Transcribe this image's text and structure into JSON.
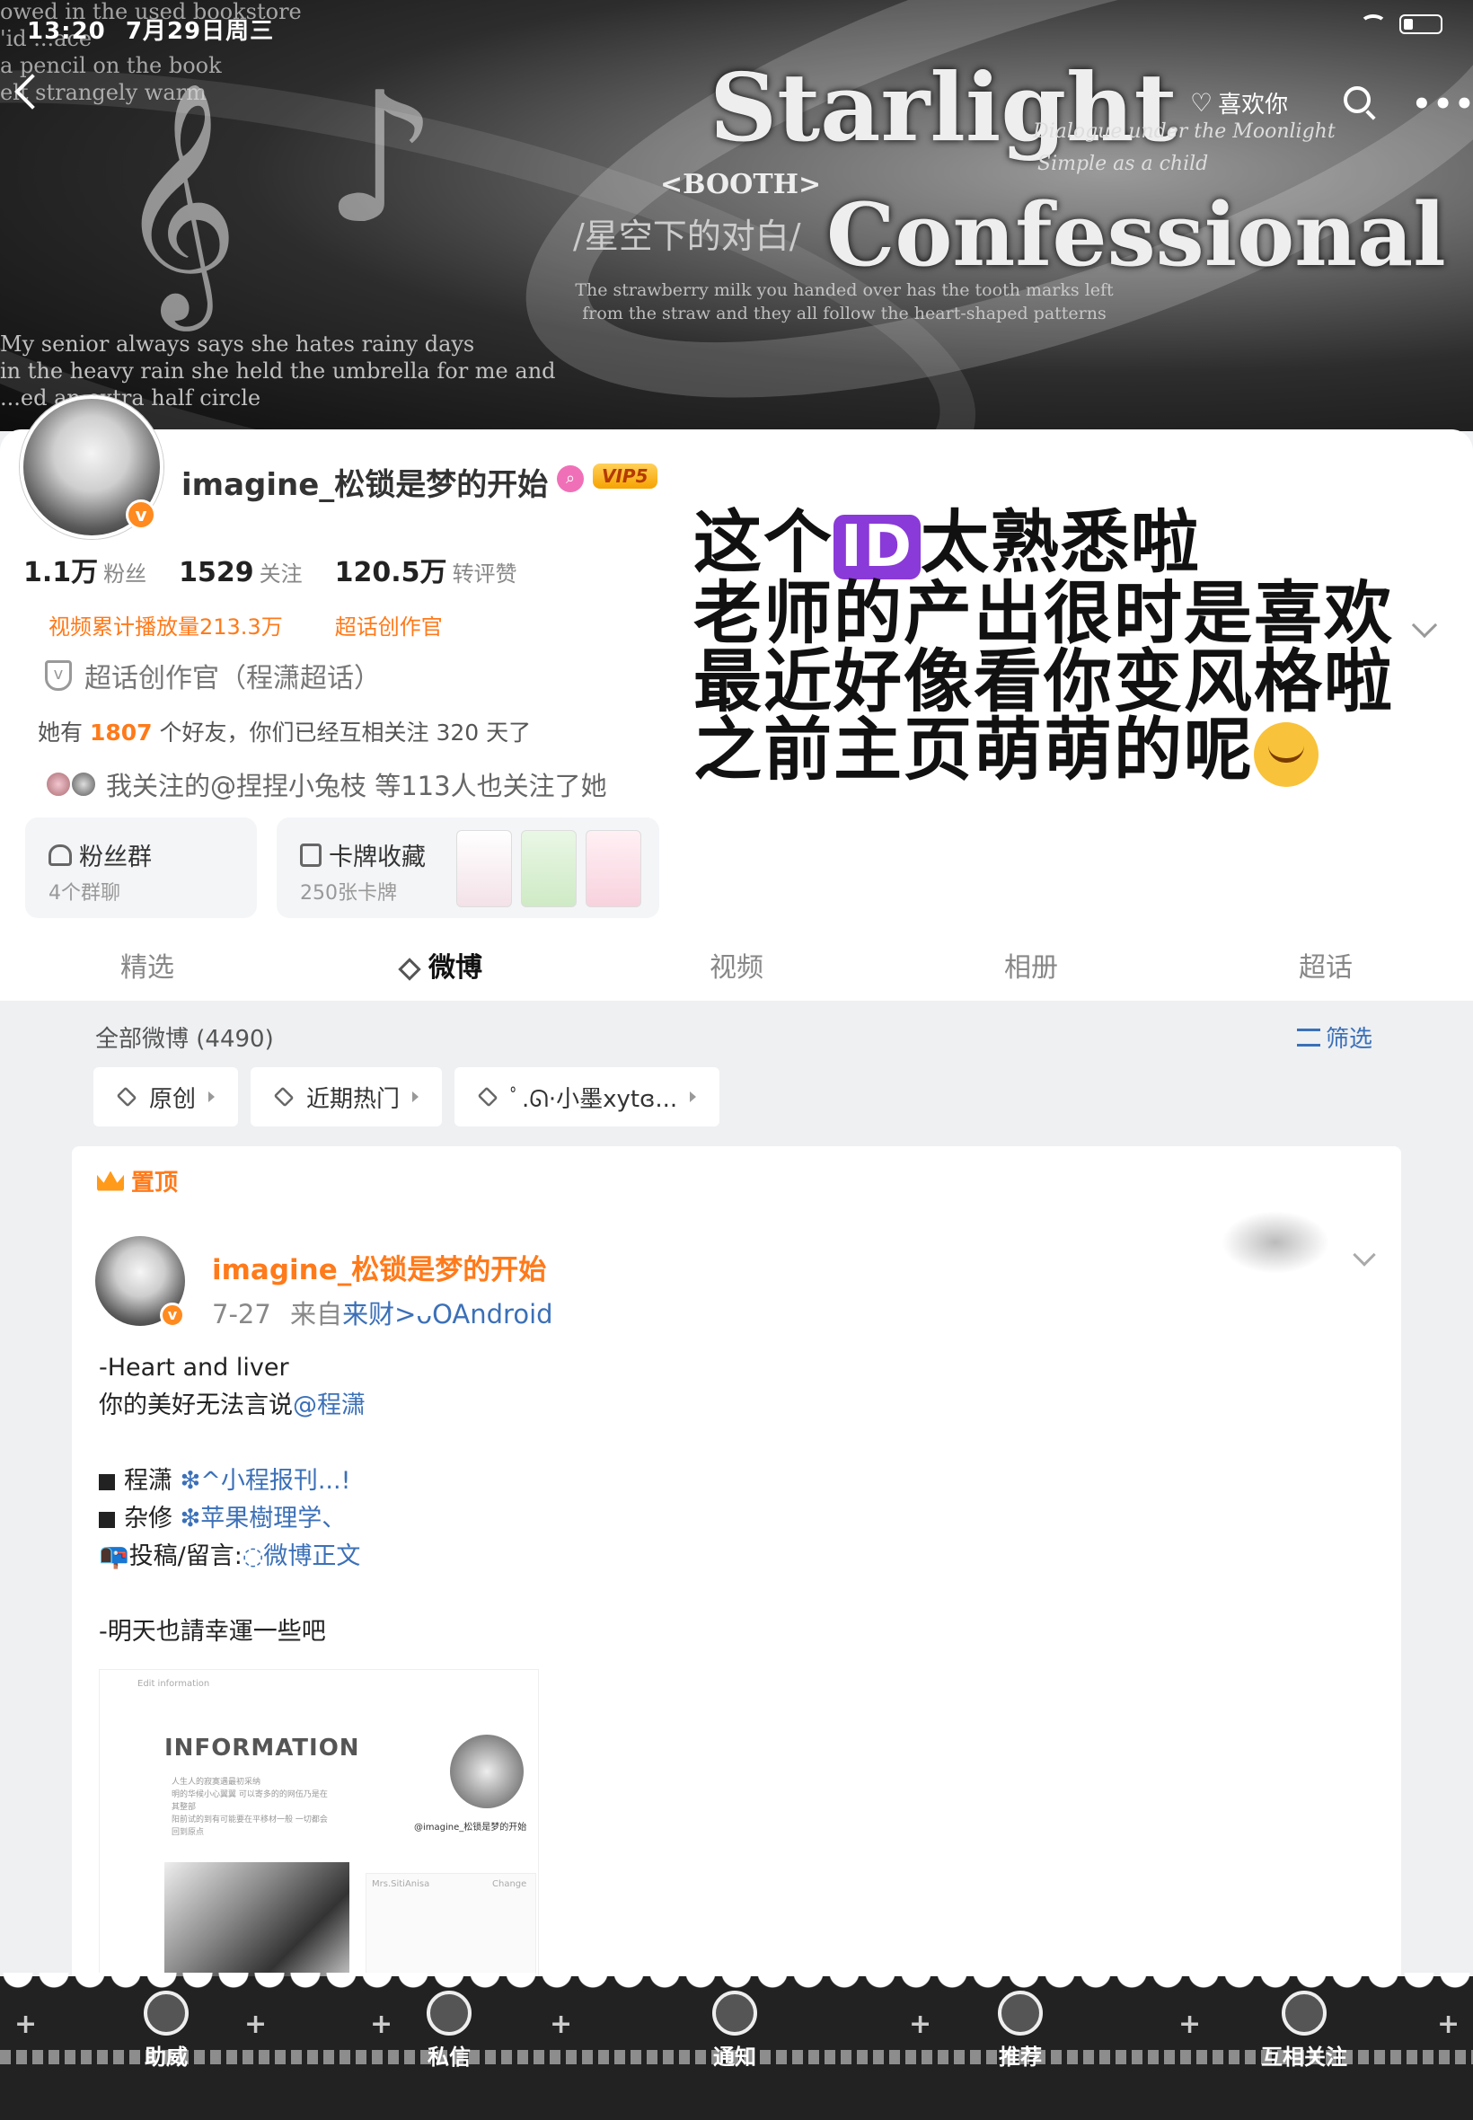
{
  "status_bar": {
    "time": "13:20",
    "date": "7月29日周三"
  },
  "banner": {
    "title_line1": "Starlight",
    "title_line2": "Confessional",
    "booth": "<BOOTH>",
    "subtitle_cn": "/星空下的对白/",
    "subtitle_en1": "Dialogue under the Moonlight",
    "subtitle_en2": "Simple as a child",
    "caption_center": "The strawberry milk you handed over has the tooth marks left from the straw and they all follow the heart-shaped patterns",
    "caption_left": "My senior always says she hates rainy days\nin the heavy rain she held the umbrella for me and\n...ed an extra half circle",
    "caption_top": "owed in the used bookstore\n'id ...ace\na pencil on the book\nelt strangely warm"
  },
  "header_actions": {
    "like_label": "喜欢你"
  },
  "profile": {
    "username": "imagine_松锁是梦的开始",
    "vip": "VIP5",
    "stats": [
      {
        "value": "1.1万",
        "label": "粉丝"
      },
      {
        "value": "1529",
        "label": "关注"
      },
      {
        "value": "120.5万",
        "label": "转评赞"
      }
    ],
    "tag_views": "视频累计播放量213.3万",
    "tag_creator": "超话创作官",
    "cert": "超话创作官（程潇超话）",
    "friends_prefix": "她有",
    "friends_count": "1807",
    "friends_suffix": "个好友，你们已经互相关注 320 天了",
    "mutual": "我关注的@捏捏小兔枝 等113人也关注了她",
    "fan_group": {
      "title": "粉丝群",
      "sub": "4个群聊"
    },
    "card_collection": {
      "title": "卡牌收藏",
      "sub": "250张卡牌"
    }
  },
  "overlay_comment": {
    "line1_a": "这个",
    "line1_badge": "ID",
    "line1_b": "太熟悉啦",
    "line2": "老师的产出很时是喜欢",
    "line3": "最近好像看你变风格啦",
    "line4": "之前主页萌萌的呢"
  },
  "tabs": [
    "精选",
    "微博",
    "视频",
    "相册",
    "超话"
  ],
  "feed": {
    "count_label": "全部微博 (4490)",
    "filter_label": "筛选",
    "chips": [
      "原创",
      "近期热门",
      "ﾟ.ᘏ·小墨xytɞ..."
    ]
  },
  "post": {
    "pin_label": "置顶",
    "author": "imagine_松锁是梦的开始",
    "date": "7-27",
    "source_prefix": "来自",
    "source": "来财>ᴗOAndroid",
    "lines": {
      "l1": "-Heart and liver",
      "l2_a": "你的美好无法言说",
      "l2_link": "@程潇",
      "l3_a": "程潇",
      "l3_link": "❇^小程报刊...!",
      "l4_a": "杂修",
      "l4_link": "❇苹果樹理学、",
      "l5_a": "📭投稿/留言:",
      "l5_link": "◌微博正文",
      "l6": "-明天也請幸運一些吧"
    },
    "image": {
      "edit_label": "Edit information",
      "heading": "INFORMATION",
      "body": "人生人的寂寞遇最初采纳\n明的华候小心翼翼 可以寄多的的网伍乃是在其整部\n阳前试的到有可能要在平移材一般 一切都会回到原点",
      "handle": "@imagine_松锁是梦的开始",
      "chat_name": "Mrs.SitiAnisa",
      "chat_change": "Change"
    }
  },
  "bottom_nav": [
    "助威",
    "私信",
    "通知",
    "推荐",
    "互相关注"
  ]
}
